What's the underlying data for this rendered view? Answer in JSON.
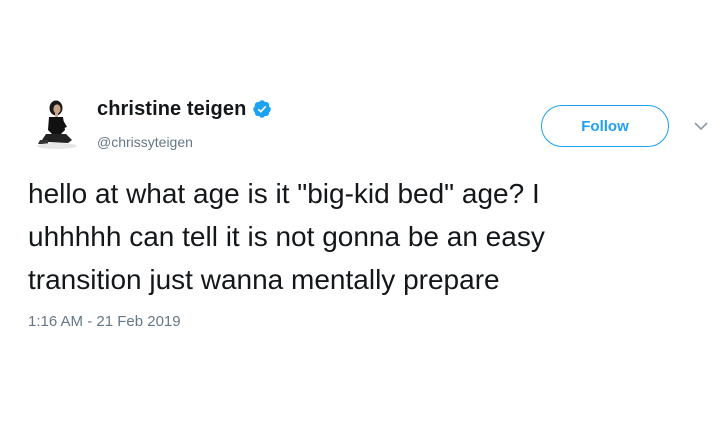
{
  "tweet": {
    "display_name": "christine teigen",
    "handle": "@chrissyteigen",
    "verified": true,
    "follow_label": "Follow",
    "text_lines": [
      "hello at what age is it \"big-kid bed\" age? I",
      "uhhhhh can tell it is not gonna be an easy",
      "transition just wanna mentally prepare"
    ],
    "timestamp": "1:16 AM - 21 Feb 2019"
  },
  "icons": {
    "verified": "verified-badge-icon",
    "more": "chevron-down-icon",
    "avatar": "profile-photo"
  },
  "colors": {
    "accent": "#1da1f2",
    "text_primary": "#14171a",
    "text_secondary": "#657786"
  }
}
